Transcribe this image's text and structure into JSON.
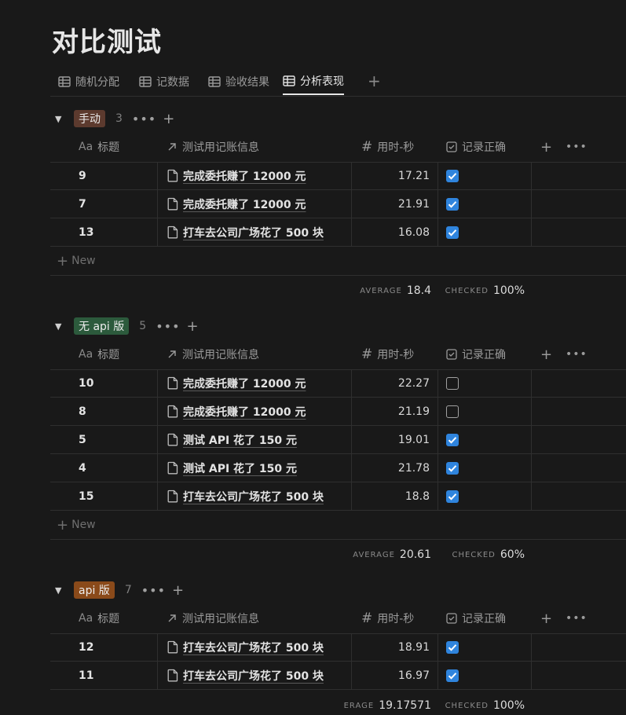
{
  "page": {
    "title": "对比测试"
  },
  "tabs": [
    {
      "label": "随机分配",
      "active": false
    },
    {
      "label": "记数据",
      "active": false
    },
    {
      "label": "验收结果",
      "active": false
    },
    {
      "label": "分析表现",
      "active": true
    }
  ],
  "columns": {
    "title": "标题",
    "relation": "测试用记账信息",
    "time": "用时-秒",
    "correct": "记录正确",
    "title_prefix": "Aa"
  },
  "new_label": "New",
  "groups": [
    {
      "name": "手动",
      "color": "#5c3a2e",
      "count": "3",
      "rows": [
        {
          "title": "9",
          "relation": "完成委托赚了 12000 元",
          "time": "17.21",
          "checked": true
        },
        {
          "title": "7",
          "relation": "完成委托赚了 12000 元",
          "time": "21.91",
          "checked": true
        },
        {
          "title": "13",
          "relation": "打车去公司广场花了 500 块",
          "time": "16.08",
          "checked": true
        }
      ],
      "average_label": "AVERAGE",
      "average": "18.4",
      "checked_label": "CHECKED",
      "checked_pct": "100%"
    },
    {
      "name": "无 api 版",
      "color": "#2c5a3c",
      "count": "5",
      "rows": [
        {
          "title": "10",
          "relation": "完成委托赚了 12000 元",
          "time": "22.27",
          "checked": false
        },
        {
          "title": "8",
          "relation": "完成委托赚了 12000 元",
          "time": "21.19",
          "checked": false
        },
        {
          "title": "5",
          "relation": "测试 API 花了 150 元",
          "time": "19.01",
          "checked": true
        },
        {
          "title": "4",
          "relation": "测试 API 花了 150 元",
          "time": "21.78",
          "checked": true
        },
        {
          "title": "15",
          "relation": "打车去公司广场花了 500 块",
          "time": "18.8",
          "checked": true
        }
      ],
      "average_label": "AVERAGE",
      "average": "20.61",
      "checked_label": "CHECKED",
      "checked_pct": "60%"
    },
    {
      "name": "api 版",
      "color": "#8a4a1a",
      "count": "7",
      "rows": [
        {
          "title": "12",
          "relation": "打车去公司广场花了 500 块",
          "time": "18.91",
          "checked": true
        },
        {
          "title": "11",
          "relation": "打车去公司广场花了 500 块",
          "time": "16.97",
          "checked": true
        }
      ],
      "average_label": "ERAGE",
      "average": "19.17571",
      "checked_label": "CHECKED",
      "checked_pct": "100%"
    }
  ]
}
